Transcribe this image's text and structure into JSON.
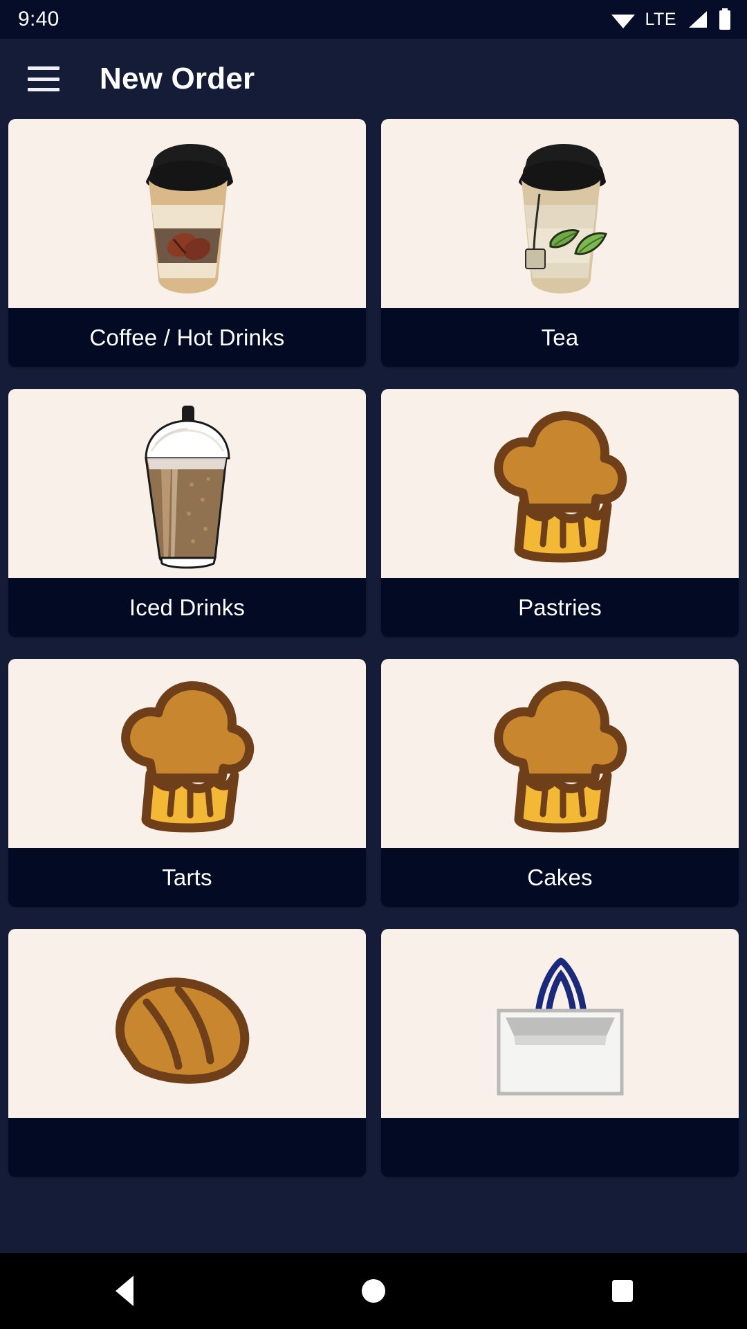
{
  "status_bar": {
    "time": "9:40",
    "network_label": "LTE",
    "icons": [
      "wifi-icon",
      "lte-label",
      "cellular-signal-icon",
      "battery-icon"
    ]
  },
  "app_bar": {
    "menu_icon": "hamburger-menu-icon",
    "title": "New Order"
  },
  "colors": {
    "app_background": "#151C38",
    "status_bar_background": "#060D29",
    "card_background": "#030B24",
    "thumbnail_background": "#FAF0EA",
    "label_text": "#FFFFFF",
    "nav_bar_background": "#000000"
  },
  "categories": [
    {
      "label": "Coffee / Hot Drinks",
      "icon": "coffee-cup-icon"
    },
    {
      "label": "Tea",
      "icon": "tea-cup-icon"
    },
    {
      "label": "Iced Drinks",
      "icon": "iced-drink-icon"
    },
    {
      "label": "Pastries",
      "icon": "muffin-icon"
    },
    {
      "label": "Tarts",
      "icon": "muffin-icon"
    },
    {
      "label": "Cakes",
      "icon": "muffin-icon"
    },
    {
      "label": "",
      "icon": "bread-loaf-icon"
    },
    {
      "label": "",
      "icon": "shopping-bag-icon"
    }
  ],
  "nav_bar": {
    "back_label": "Back",
    "home_label": "Home",
    "recents_label": "Recents"
  }
}
